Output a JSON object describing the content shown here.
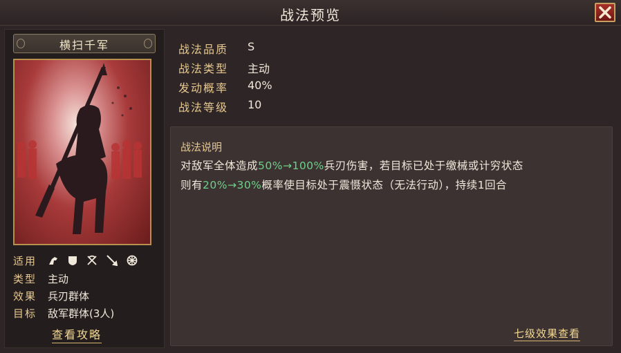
{
  "window": {
    "title": "战法预览",
    "close_icon": "close-icon"
  },
  "skill": {
    "name": "横扫千军",
    "attrs": [
      {
        "key": "适用",
        "value": ""
      },
      {
        "key": "类型",
        "value": "主动"
      },
      {
        "key": "效果",
        "value": "兵刃群体"
      },
      {
        "key": "目标",
        "value": "敌军群体(3人)"
      }
    ],
    "unit_icons": [
      "cavalry-icon",
      "shield-icon",
      "bow-icon",
      "spear-icon",
      "wheel-icon"
    ],
    "guide_button": "查看攻略"
  },
  "info": {
    "quality": {
      "label": "战法品质",
      "value": "S"
    },
    "type": {
      "label": "战法类型",
      "value": "主动"
    },
    "rate": {
      "label": "发动概率",
      "value": "40%"
    },
    "level": {
      "label": "战法等级",
      "value": "10"
    }
  },
  "description": {
    "heading": "战法说明",
    "line1": {
      "a": "对敌军全体造成",
      "b": "50%→100%",
      "c": "兵刃伤害，若目标已处于缴械或计穷状态"
    },
    "line2": {
      "a": "则有",
      "b": "20%→30%",
      "c": "概率使目标处于震慑状态（无法行动），持续1回合"
    },
    "level7_button": "七级效果查看"
  },
  "colors": {
    "accent_gold": "#e6c890",
    "highlight_green": "#6fd08a",
    "background": "#2e2626"
  }
}
